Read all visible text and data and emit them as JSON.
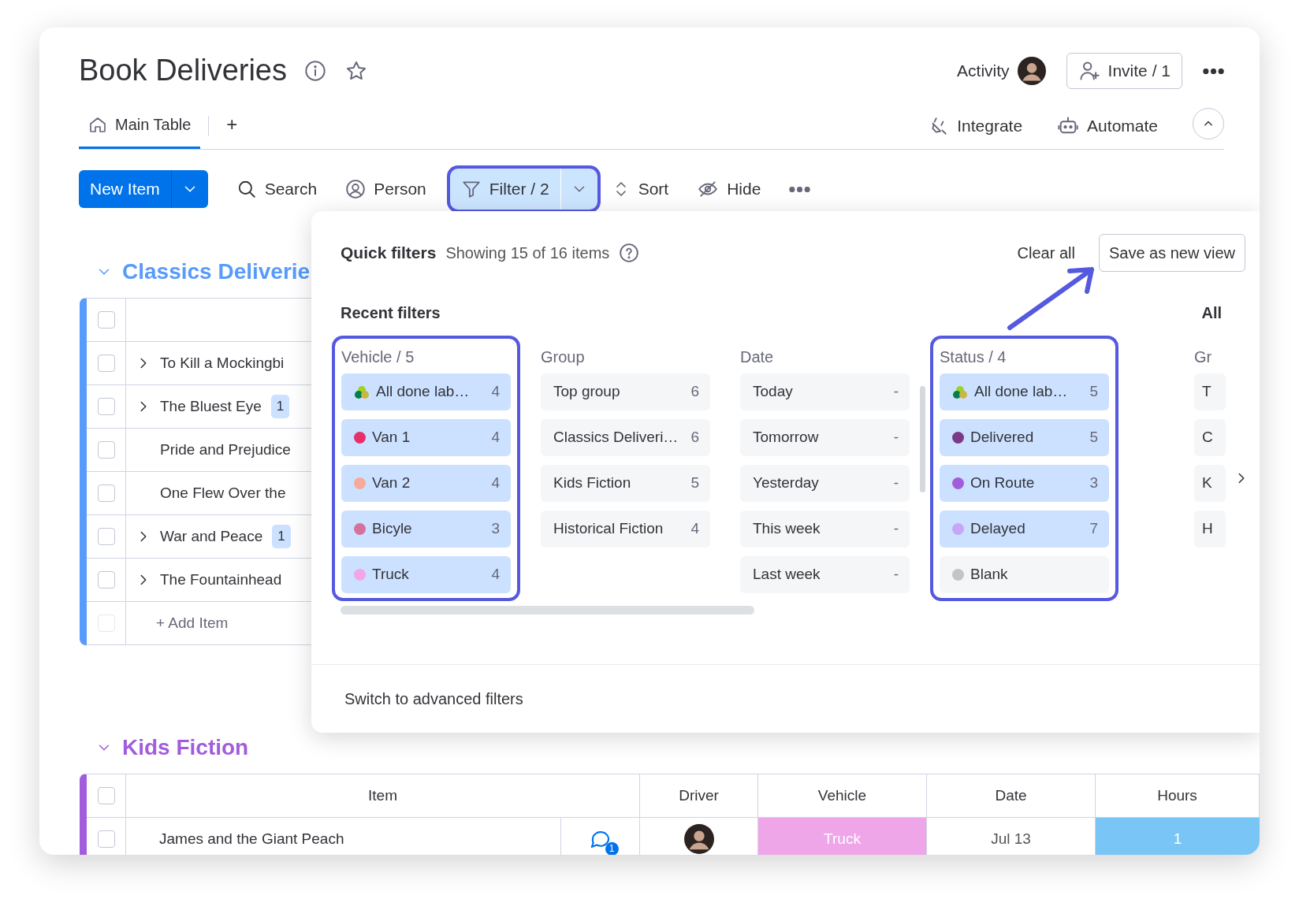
{
  "board": {
    "title": "Book Deliveries",
    "activity": "Activity",
    "invite": "Invite / 1",
    "views": [
      {
        "label": "Main Table",
        "selected": true
      }
    ],
    "add_view": "+",
    "integrate": "Integrate",
    "automate": "Automate"
  },
  "toolbar": {
    "new_item": "New Item",
    "search": "Search",
    "person": "Person",
    "filter": {
      "label": "Filter / 2",
      "active": true,
      "highlighted": true
    },
    "sort": "Sort",
    "hide": "Hide"
  },
  "filter_panel": {
    "title": "Quick filters",
    "summary": "Showing 15 of 16 items",
    "clear_all": "Clear all",
    "save_view": "Save as new view",
    "section": "Recent filters",
    "next_section": "All",
    "columns": [
      {
        "title": "Vehicle / 5",
        "highlighted": true,
        "items": [
          {
            "kind": "all",
            "label": "All done lab…",
            "count": "4",
            "selected": true
          },
          {
            "kind": "dot",
            "label": "Van 1",
            "count": "4",
            "selected": true,
            "color": "#e5306c"
          },
          {
            "kind": "dot",
            "label": "Van 2",
            "count": "4",
            "selected": true,
            "color": "#f5aa9a"
          },
          {
            "kind": "dot",
            "label": "Bicyle",
            "count": "3",
            "selected": true,
            "color": "#d5719c"
          },
          {
            "kind": "dot",
            "label": "Truck",
            "count": "4",
            "selected": true,
            "color": "#f1a6ea"
          }
        ]
      },
      {
        "title": "Group",
        "highlighted": false,
        "items": [
          {
            "kind": "plain",
            "label": "Top group",
            "count": "6",
            "selected": false
          },
          {
            "kind": "plain",
            "label": "Classics Deliveri…",
            "count": "6",
            "selected": false
          },
          {
            "kind": "plain",
            "label": "Kids Fiction",
            "count": "5",
            "selected": false
          },
          {
            "kind": "plain",
            "label": "Historical Fiction",
            "count": "4",
            "selected": false
          }
        ]
      },
      {
        "title": "Date",
        "highlighted": false,
        "items": [
          {
            "kind": "plain",
            "label": "Today",
            "count": "-",
            "selected": false
          },
          {
            "kind": "plain",
            "label": "Tomorrow",
            "count": "-",
            "selected": false
          },
          {
            "kind": "plain",
            "label": "Yesterday",
            "count": "-",
            "selected": false
          },
          {
            "kind": "plain",
            "label": "This week",
            "count": "-",
            "selected": false
          },
          {
            "kind": "plain",
            "label": "Last week",
            "count": "-",
            "selected": false
          }
        ]
      },
      {
        "title": "Status / 4",
        "highlighted": true,
        "items": [
          {
            "kind": "all",
            "label": "All done lab…",
            "count": "5",
            "selected": true
          },
          {
            "kind": "dot",
            "label": "Delivered",
            "count": "5",
            "selected": true,
            "color": "#7b3a86"
          },
          {
            "kind": "dot",
            "label": "On Route",
            "count": "3",
            "selected": true,
            "color": "#a25ddc"
          },
          {
            "kind": "dot",
            "label": "Delayed",
            "count": "7",
            "selected": true,
            "color": "#c6a7f5"
          },
          {
            "kind": "dot",
            "label": "Blank",
            "selected": false,
            "color": "#c4c4c4"
          }
        ]
      },
      {
        "title": "Gr",
        "highlighted": false,
        "items": [
          {
            "kind": "plain",
            "label": "T",
            "selected": false
          },
          {
            "kind": "plain",
            "label": "C",
            "selected": false
          },
          {
            "kind": "plain",
            "label": "K",
            "selected": false
          },
          {
            "kind": "plain",
            "label": "H",
            "selected": false
          }
        ]
      }
    ],
    "advanced": "Switch to advanced filters"
  },
  "groups": [
    {
      "title": "Classics Deliverie",
      "color": "#579bfc",
      "expanded": true,
      "select_all": false,
      "rows": [
        {
          "name": "To Kill a Mockingbi",
          "expandable": true,
          "checked": false
        },
        {
          "name": "The Bluest Eye",
          "expandable": true,
          "subitems": "1",
          "checked": false
        },
        {
          "name": "Pride and Prejudice",
          "expandable": false,
          "checked": false
        },
        {
          "name": "One Flew Over the",
          "expandable": false,
          "checked": false
        },
        {
          "name": "War and Peace",
          "expandable": true,
          "subitems": "1",
          "checked": false
        },
        {
          "name": "The Fountainhead",
          "expandable": true,
          "checked": false
        }
      ],
      "add_item": "+ Add Item",
      "add_item_checkbox": {
        "checked": false,
        "disabled": true
      }
    },
    {
      "title": "Kids Fiction",
      "color": "#a25ddc",
      "expanded": true,
      "select_all": false,
      "columns": [
        "Item",
        "Driver",
        "Vehicle",
        "Date",
        "Hours"
      ],
      "rows": [
        {
          "name": "James and the Giant Peach",
          "updates": "1",
          "vehicle": {
            "label": "Truck",
            "color": "#efa6e9"
          },
          "date": "Jul 13",
          "hours": "1",
          "checked": false
        }
      ]
    }
  ]
}
